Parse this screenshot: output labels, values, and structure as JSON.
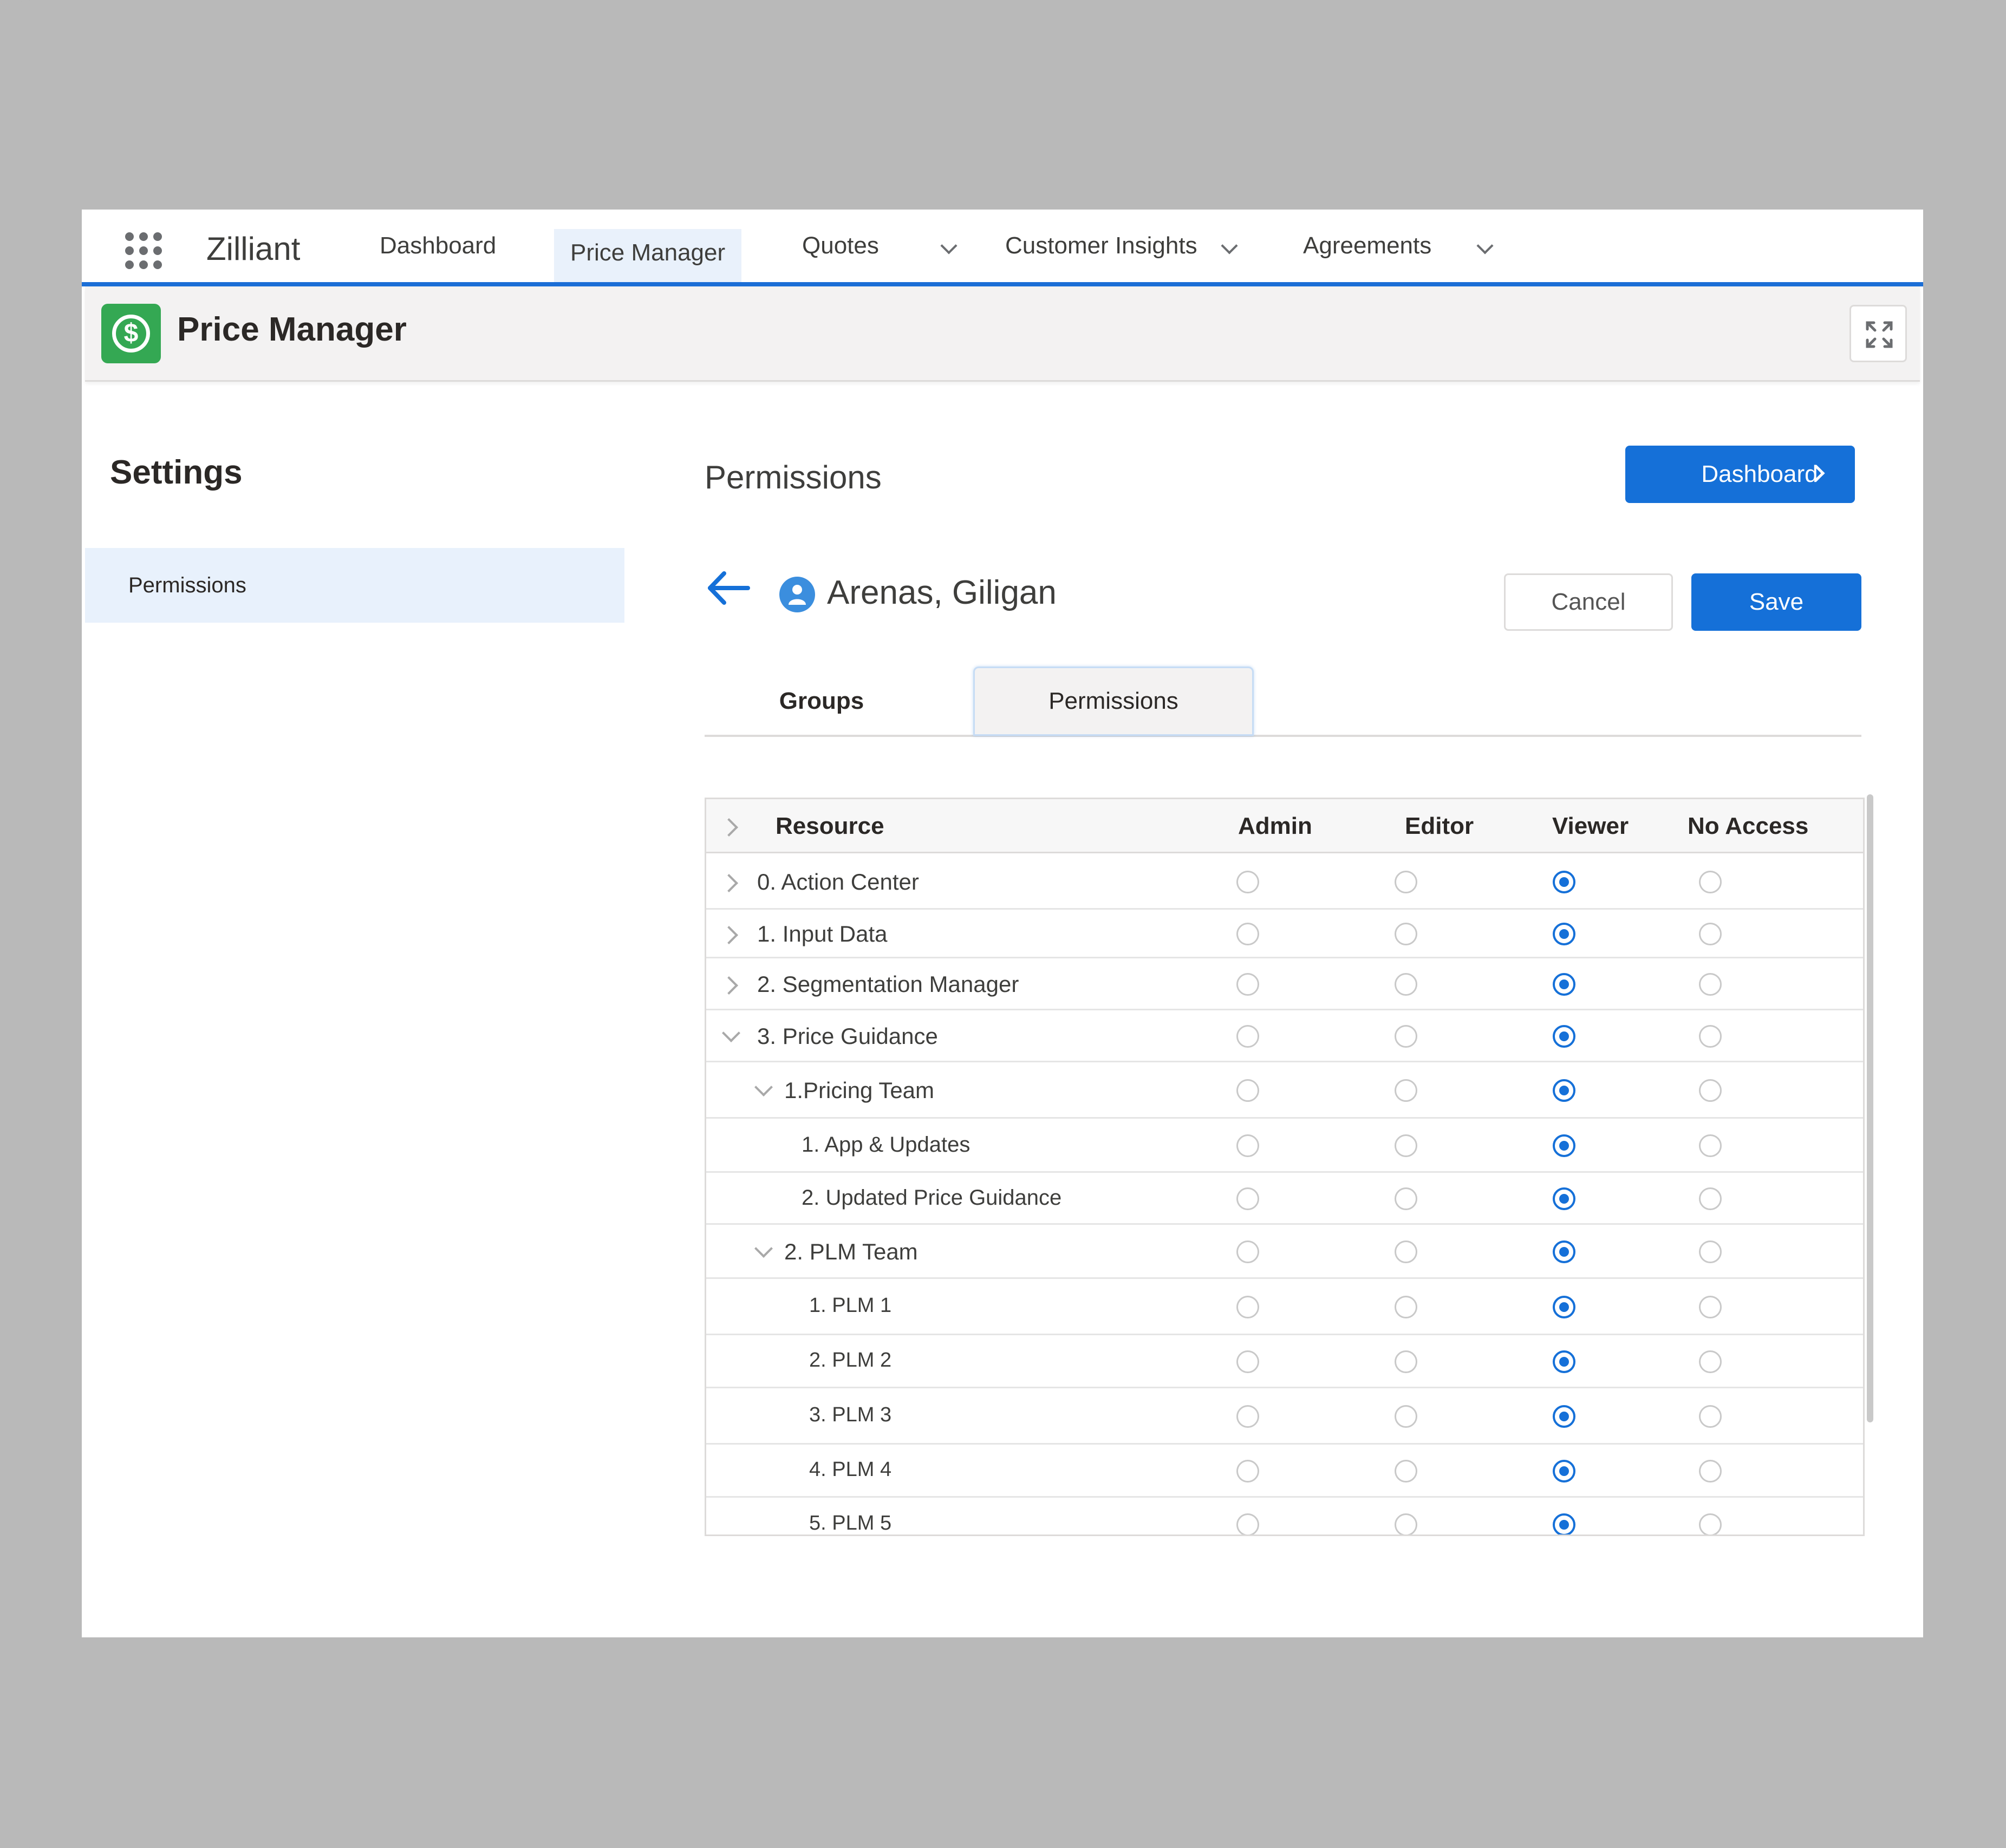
{
  "topnav": {
    "brand": "Zilliant",
    "items": [
      {
        "label": "Dashboard",
        "active": false,
        "dropdown": false
      },
      {
        "label": "Price Manager",
        "active": true,
        "dropdown": false
      },
      {
        "label": "Quotes",
        "active": false,
        "dropdown": true
      },
      {
        "label": "Customer Insights",
        "active": false,
        "dropdown": true
      },
      {
        "label": "Agreements",
        "active": false,
        "dropdown": true
      }
    ]
  },
  "header": {
    "title": "Price Manager",
    "app_icon": "dollar-icon",
    "expand_icon": "expand-icon"
  },
  "sidebar": {
    "title": "Settings",
    "items": [
      {
        "label": "Permissions",
        "selected": true
      }
    ]
  },
  "main": {
    "title": "Permissions",
    "dashboard_button": "Dashboard",
    "user": {
      "name": "Arenas, Giligan"
    },
    "cancel_label": "Cancel",
    "save_label": "Save",
    "tabs": [
      {
        "label": "Groups",
        "active": false
      },
      {
        "label": "Permissions",
        "active": true
      }
    ]
  },
  "table": {
    "headers": {
      "resource": "Resource",
      "admin": "Admin",
      "editor": "Editor",
      "viewer": "Viewer",
      "no_access": "No Access"
    },
    "rows": [
      {
        "label": "0. Action Center",
        "level": 0,
        "expander": "right",
        "selected": "viewer"
      },
      {
        "label": "1. Input Data",
        "level": 0,
        "expander": "right",
        "selected": "viewer"
      },
      {
        "label": "2. Segmentation Manager",
        "level": 0,
        "expander": "right",
        "selected": "viewer"
      },
      {
        "label": "3. Price Guidance",
        "level": 0,
        "expander": "down",
        "selected": "viewer"
      },
      {
        "label": "1.Pricing Team",
        "level": 1,
        "expander": "down",
        "selected": "viewer"
      },
      {
        "label": "1. App & Updates",
        "level": 2,
        "expander": "",
        "selected": "viewer"
      },
      {
        "label": "2. Updated Price Guidance",
        "level": 2,
        "expander": "",
        "selected": "viewer"
      },
      {
        "label": "2. PLM Team",
        "level": 1,
        "expander": "down",
        "selected": "viewer"
      },
      {
        "label": "1. PLM 1",
        "level": 3,
        "expander": "",
        "selected": "viewer"
      },
      {
        "label": "2. PLM 2",
        "level": 3,
        "expander": "",
        "selected": "viewer"
      },
      {
        "label": "3. PLM 3",
        "level": 3,
        "expander": "",
        "selected": "viewer"
      },
      {
        "label": "4. PLM 4",
        "level": 3,
        "expander": "",
        "selected": "viewer"
      },
      {
        "label": "5. PLM 5",
        "level": 3,
        "expander": "",
        "selected": "viewer"
      }
    ]
  },
  "colors": {
    "brand_blue": "#1570d8",
    "app_green": "#34a853"
  }
}
